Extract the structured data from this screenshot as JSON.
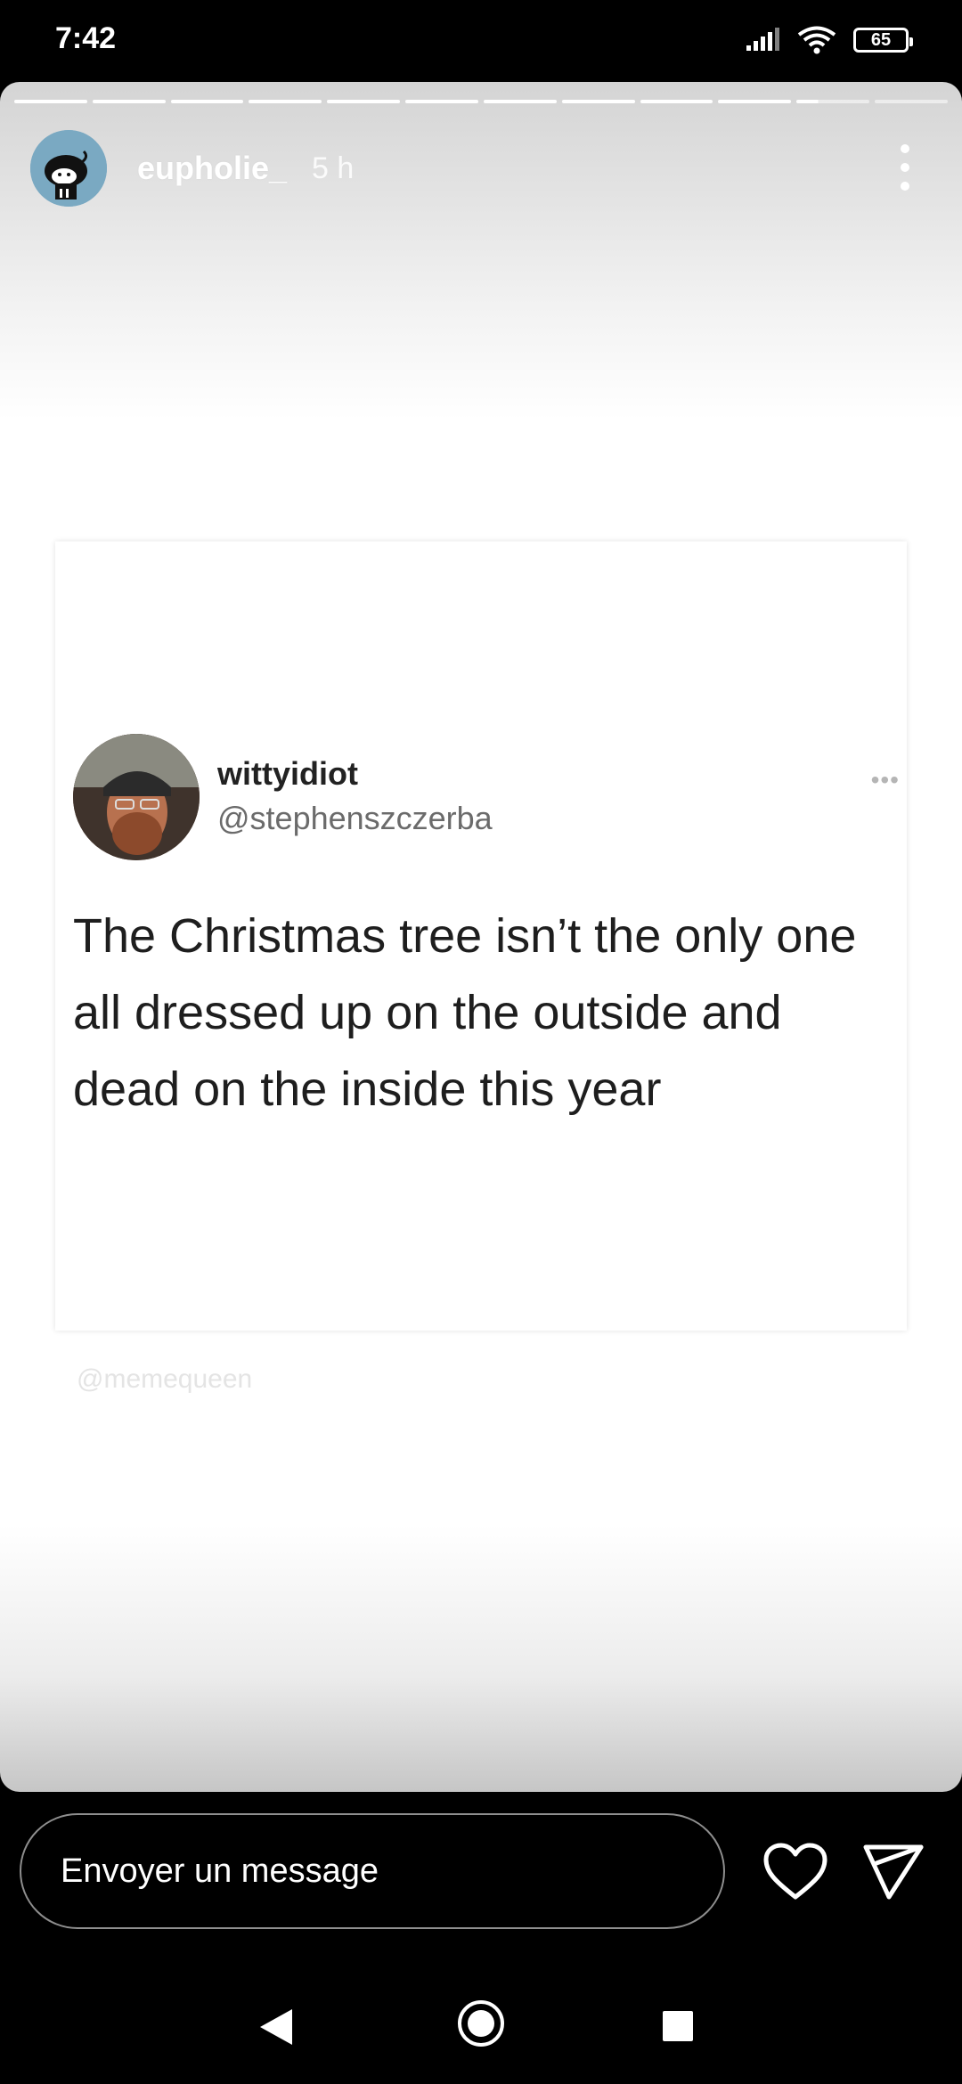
{
  "status_bar": {
    "time": "7:42",
    "battery": "65",
    "icons": [
      "signal-icon",
      "wifi-icon",
      "battery-icon"
    ]
  },
  "story": {
    "progress": {
      "segments": 12,
      "completed": 10,
      "current_fraction": 0.3
    },
    "username": "eupholie_",
    "time_ago": "5 h"
  },
  "tweet": {
    "display_name": "wittyidiot",
    "handle": "@stephenszczerba",
    "text": "The Christmas tree isn’t the only one all dressed up on the outside and dead on the inside this year",
    "more": "•••"
  },
  "watermark": "@memequeen",
  "reply_bar": {
    "placeholder": "Envoyer un message"
  },
  "nav": {
    "icons": [
      "back-icon",
      "home-icon",
      "recents-icon"
    ]
  },
  "colors": {
    "background": "#000000",
    "story_top": "#d4d4d4",
    "card": "#ffffff",
    "handle": "#6b6b6b"
  }
}
